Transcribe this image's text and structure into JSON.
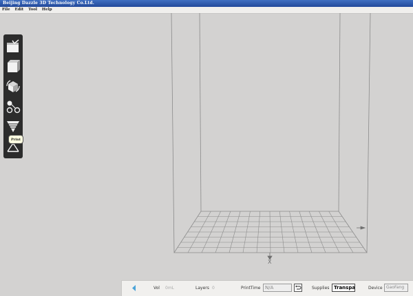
{
  "window": {
    "title": "Beijing Dazzle 3D Technology Co.Ltd."
  },
  "menu": {
    "items": [
      "File",
      "Edit",
      "Tool",
      "Help"
    ]
  },
  "toolbar": {
    "tools": [
      {
        "name": "open-file-icon"
      },
      {
        "name": "cube-icon"
      },
      {
        "name": "rotate-model-icon"
      },
      {
        "name": "support-structure-icon"
      },
      {
        "name": "slice-layers-icon"
      },
      {
        "name": "print-icon"
      }
    ],
    "tooltip": "Print"
  },
  "status": {
    "vol_label": "Vol",
    "vol_value": "0mL",
    "layers_label": "Layers",
    "layers_value": "0",
    "printtime_label": "PrintTime",
    "printtime_value": "N/A",
    "supplies_label": "Supplies",
    "supplies_value": "Transparent",
    "device_label": "Device",
    "device_value": "GaoFang"
  },
  "colors": {
    "background": "#d3d2d1",
    "titlebar": "#2a55a8",
    "toolbar": "#2c2c2c",
    "wireframe": "#8a8a8a"
  }
}
